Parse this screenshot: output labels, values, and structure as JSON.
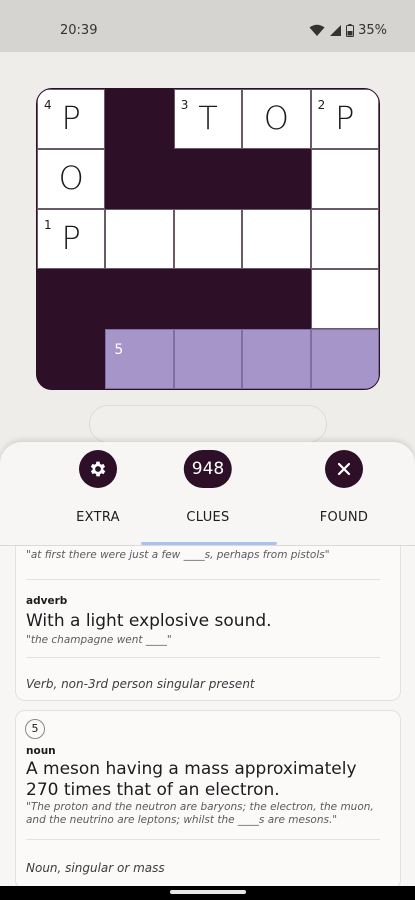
{
  "status": {
    "time": "20:39",
    "battery": "35%"
  },
  "grid": {
    "rows": [
      [
        {
          "type": "white",
          "num": "4",
          "letter": "P"
        },
        {
          "type": "black"
        },
        {
          "type": "white",
          "num": "3",
          "letter": "T"
        },
        {
          "type": "white",
          "letter": "O"
        },
        {
          "type": "white",
          "num": "2",
          "letter": "P"
        }
      ],
      [
        {
          "type": "white",
          "letter": "O"
        },
        {
          "type": "black"
        },
        {
          "type": "black"
        },
        {
          "type": "black"
        },
        {
          "type": "white"
        }
      ],
      [
        {
          "type": "white",
          "num": "1",
          "letter": "P"
        },
        {
          "type": "white"
        },
        {
          "type": "white"
        },
        {
          "type": "white"
        },
        {
          "type": "white"
        }
      ],
      [
        {
          "type": "black"
        },
        {
          "type": "black"
        },
        {
          "type": "black"
        },
        {
          "type": "black"
        },
        {
          "type": "white"
        }
      ],
      [
        {
          "type": "black"
        },
        {
          "type": "lav",
          "num": "5"
        },
        {
          "type": "lav"
        },
        {
          "type": "lav"
        },
        {
          "type": "lav"
        }
      ]
    ]
  },
  "tabs": {
    "extra": {
      "label": "EXTRA",
      "icon": "gear-icon"
    },
    "clues": {
      "label": "CLUES",
      "count": "948"
    },
    "found": {
      "label": "FOUND",
      "icon": "close-icon"
    }
  },
  "clue_cards": [
    {
      "example1": "\"at first there were just a few ____s, perhaps from pistols\"",
      "pos": "adverb",
      "definition": "With a light explosive sound.",
      "example2": "\"the champagne went ____\"",
      "grammar": "Verb, non-3rd person singular present"
    },
    {
      "number": "5",
      "pos": "noun",
      "definition": "A meson having a mass approximately 270 times that of an electron.",
      "example": "\"The proton and the neutron are baryons; the electron, the muon, and the neutrino are leptons; whilst the ____s are mesons.\"",
      "grammar": "Noun, singular or mass"
    }
  ],
  "colors": {
    "dark": "#2d0f28",
    "highlight": "#a595c9",
    "tab_indicator": "#a7c3f5"
  }
}
